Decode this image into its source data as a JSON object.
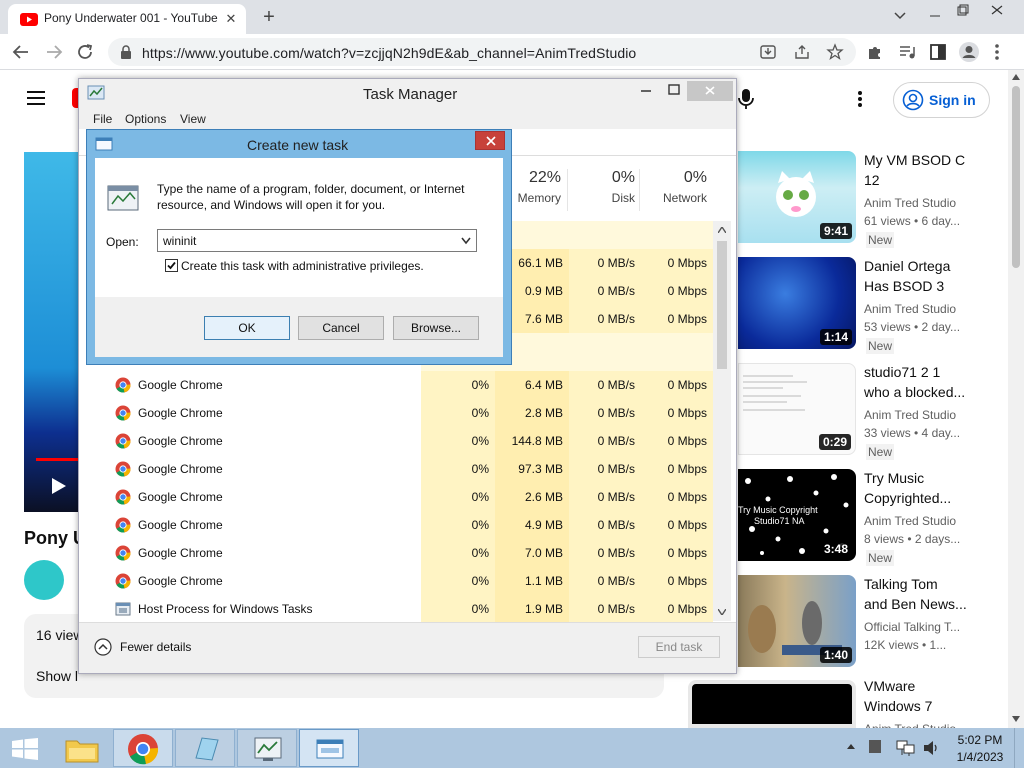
{
  "browser": {
    "tab_title": "Pony Underwater 001 - YouTube",
    "url": "https://www.youtube.com/watch?v=zcjjqN2h9dE&ab_channel=AnimTredStudio"
  },
  "youtube": {
    "sign_in": "Sign in",
    "video_title_partial": "Pony U",
    "views_partial": "16 view",
    "show_less_partial": "Show l",
    "recommended": [
      {
        "title_1": "My VM BSOD C",
        "title_2": "12",
        "channel": "Anim Tred Studio",
        "meta": "61 views • 6 day...",
        "badge": "New",
        "duration": "9:41"
      },
      {
        "title_1": "Daniel Ortega",
        "title_2": "Has BSOD 3",
        "channel": "Anim Tred Studio",
        "meta": "53 views • 2 day...",
        "badge": "New",
        "duration": "1:14"
      },
      {
        "title_1": "studio71 2 1",
        "title_2": "who a blocked...",
        "channel": "Anim Tred Studio",
        "meta": "33 views • 4 day...",
        "badge": "New",
        "duration": "0:29"
      },
      {
        "title_1": "Try Music",
        "title_2": "Copyrighted...",
        "channel": "Anim Tred Studio",
        "meta": "8 views • 2 days...",
        "badge": "New",
        "duration": "3:48",
        "thumb_text_1": "Try Music Copyright",
        "thumb_text_2": "Studio71 NA"
      },
      {
        "title_1": "Talking Tom",
        "title_2": "and Ben News...",
        "channel": "Official Talking T...",
        "meta": "12K views • 1...",
        "duration": "1:40"
      },
      {
        "title_1": "VMware",
        "title_2": "Windows 7",
        "channel": "Anim Tred Studio"
      }
    ]
  },
  "task_manager": {
    "title": "Task Manager",
    "menu": [
      "File",
      "Options",
      "View"
    ],
    "columns": [
      {
        "percent": "22%",
        "name": "Memory"
      },
      {
        "percent": "0%",
        "name": "Disk"
      },
      {
        "percent": "0%",
        "name": "Network"
      }
    ],
    "upper_rows": [
      {
        "memory": "66.1 MB",
        "disk": "0 MB/s",
        "network": "0 Mbps"
      },
      {
        "memory": "0.9 MB",
        "disk": "0 MB/s",
        "network": "0 Mbps"
      },
      {
        "memory": "7.6 MB",
        "disk": "0 MB/s",
        "network": "0 Mbps"
      }
    ],
    "rows": [
      {
        "name": "Google Chrome",
        "cpu": "0%",
        "memory": "6.4 MB",
        "disk": "0 MB/s",
        "network": "0 Mbps"
      },
      {
        "name": "Google Chrome",
        "cpu": "0%",
        "memory": "2.8 MB",
        "disk": "0 MB/s",
        "network": "0 Mbps"
      },
      {
        "name": "Google Chrome",
        "cpu": "0%",
        "memory": "144.8 MB",
        "disk": "0 MB/s",
        "network": "0 Mbps"
      },
      {
        "name": "Google Chrome",
        "cpu": "0%",
        "memory": "97.3 MB",
        "disk": "0 MB/s",
        "network": "0 Mbps"
      },
      {
        "name": "Google Chrome",
        "cpu": "0%",
        "memory": "2.6 MB",
        "disk": "0 MB/s",
        "network": "0 Mbps"
      },
      {
        "name": "Google Chrome",
        "cpu": "0%",
        "memory": "4.9 MB",
        "disk": "0 MB/s",
        "network": "0 Mbps"
      },
      {
        "name": "Google Chrome",
        "cpu": "0%",
        "memory": "7.0 MB",
        "disk": "0 MB/s",
        "network": "0 Mbps"
      },
      {
        "name": "Google Chrome",
        "cpu": "0%",
        "memory": "1.1 MB",
        "disk": "0 MB/s",
        "network": "0 Mbps"
      },
      {
        "name": "Host Process for Windows Tasks",
        "cpu": "0%",
        "memory": "1.9 MB",
        "disk": "0 MB/s",
        "network": "0 Mbps"
      }
    ],
    "fewer_details": "Fewer details",
    "end_task": "End task"
  },
  "run_dialog": {
    "title": "Create new task",
    "description_1": "Type the name of a program, folder, document, or Internet",
    "description_2": "resource, and Windows will open it for you.",
    "open_label": "Open:",
    "open_value": "wininit",
    "admin_checkbox_label": "Create this task with administrative privileges.",
    "admin_checked": true,
    "ok": "OK",
    "cancel": "Cancel",
    "browse": "Browse..."
  },
  "taskbar": {
    "time": "5:02 PM",
    "date": "1/4/2023"
  },
  "colors": {
    "youtube_red": "#ff0000",
    "link_blue": "#065fd4",
    "dialog_frame": "#7cb9e4",
    "taskbar": "#aec7df",
    "cell_highlight": "#fff4c4"
  }
}
